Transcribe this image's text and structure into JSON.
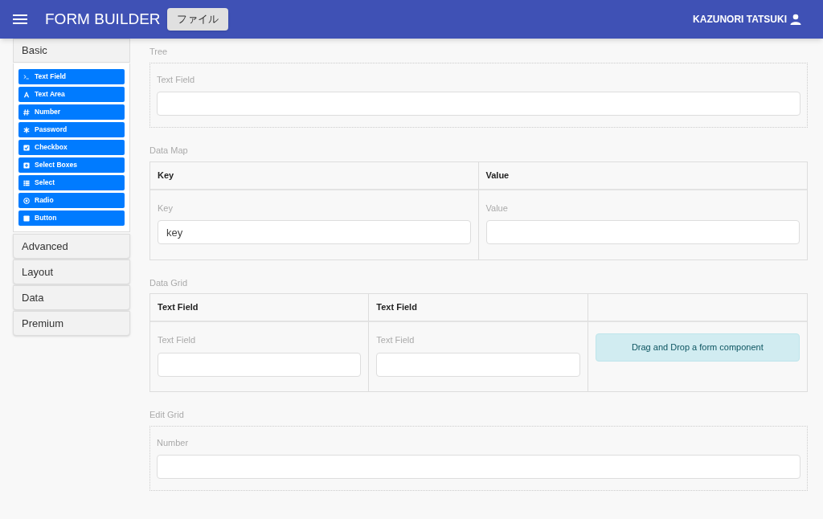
{
  "app_bar": {
    "title": "FORM BUILDER",
    "menu_button": "ファイル",
    "user": "KAZUNORI TATSUKI"
  },
  "sidebar": {
    "groups": [
      {
        "title": "Basic",
        "expanded": true,
        "components": [
          {
            "kind": "terminal",
            "label": "Text Field"
          },
          {
            "kind": "font",
            "label": "Text Area"
          },
          {
            "kind": "hash",
            "label": "Number"
          },
          {
            "kind": "asterisk",
            "label": "Password"
          },
          {
            "kind": "check",
            "label": "Checkbox"
          },
          {
            "kind": "plus",
            "label": "Select Boxes"
          },
          {
            "kind": "list",
            "label": "Select"
          },
          {
            "kind": "radio",
            "label": "Radio"
          },
          {
            "kind": "stop",
            "label": "Button"
          }
        ]
      },
      {
        "title": "Advanced",
        "expanded": false
      },
      {
        "title": "Layout",
        "expanded": false
      },
      {
        "title": "Data",
        "expanded": false
      },
      {
        "title": "Premium",
        "expanded": false
      }
    ]
  },
  "canvas": {
    "sections": [
      {
        "kind": "panel",
        "title": "Tree",
        "fields": [
          {
            "label": "Text Field"
          }
        ]
      },
      {
        "kind": "table",
        "title": "Data Map",
        "columns": [
          "Key",
          "Value"
        ],
        "cells": [
          {
            "kind": "field",
            "label": "Key",
            "value": "key"
          },
          {
            "kind": "field",
            "label": "Value"
          }
        ]
      },
      {
        "kind": "table",
        "title": "Data Grid",
        "columns": [
          "Text Field",
          "Text Field",
          null
        ],
        "cells": [
          {
            "kind": "field",
            "label": "Text Field"
          },
          {
            "kind": "field",
            "label": "Text Field"
          },
          {
            "kind": "dropzone",
            "text": "Drag and Drop a form component"
          }
        ]
      },
      {
        "kind": "panel",
        "title": "Edit Grid",
        "fields": [
          {
            "label": "Number"
          }
        ]
      }
    ]
  }
}
